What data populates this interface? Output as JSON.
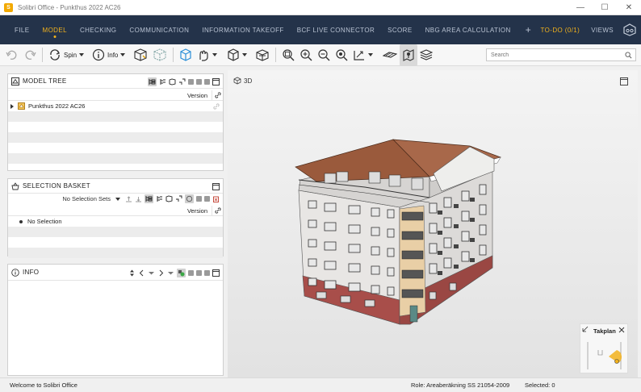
{
  "window": {
    "title": "Solibri Office - Punkthus 2022 AC26",
    "logo_letter": "S",
    "controls": [
      "—",
      "☐",
      "✕"
    ]
  },
  "menu": {
    "items": [
      {
        "label": "FILE",
        "active": false
      },
      {
        "label": "MODEL",
        "active": true
      },
      {
        "label": "CHECKING",
        "active": false
      },
      {
        "label": "COMMUNICATION",
        "active": false
      },
      {
        "label": "INFORMATION TAKEOFF",
        "active": false
      },
      {
        "label": "BCF LIVE CONNECTOR",
        "active": false
      },
      {
        "label": "SCORE",
        "active": false
      },
      {
        "label": "NBG AREA CALCULATION",
        "active": false
      }
    ],
    "plus": "+",
    "todo": "TO-DO (0/1)",
    "views": "VIEWS"
  },
  "toolbar": {
    "spin_label": "Spin",
    "info_label": "Info",
    "search_placeholder": "Search"
  },
  "model_tree": {
    "title": "MODEL TREE",
    "version_col": "Version",
    "items": [
      {
        "label": "Punkthus 2022 AC26"
      }
    ]
  },
  "selection_basket": {
    "title": "SELECTION BASKET",
    "sets_label": "No Selection Sets",
    "version_col": "Version",
    "items": [
      {
        "label": "No Selection"
      }
    ]
  },
  "info_panel": {
    "title": "INFO"
  },
  "viewport": {
    "label": "3D",
    "takplan_title": "Takplan"
  },
  "status": {
    "message": "Welcome to Solibri Office",
    "role": "Role: Areaberäkning SS 21054-2009",
    "selected": "Selected: 0"
  },
  "colors": {
    "menu_bg": "#24334a",
    "accent": "#f2b21c",
    "roof": "#9a5a3c",
    "base": "#a84e4a"
  }
}
